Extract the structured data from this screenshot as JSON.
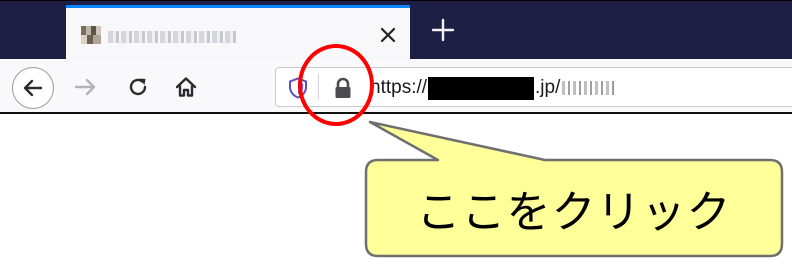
{
  "browser": {
    "tab": {
      "favicon_icon": "site-favicon-pixelated",
      "close_icon": "×"
    },
    "new_tab_icon": "+",
    "toolbar": {
      "back_icon": "arrow-left-icon",
      "forward_icon": "arrow-right-icon",
      "reload_icon": "reload-icon",
      "home_icon": "home-icon"
    },
    "urlbar": {
      "shield_icon": "tracking-protection-shield-icon",
      "lock_icon": "padlock-icon",
      "url_prefix": "https://",
      "url_suffix": ".jp/"
    }
  },
  "annotation": {
    "callout_text": "ここをクリック",
    "highlight_color": "#ff0000",
    "callout_fill": "#ffff99"
  },
  "colors": {
    "titlebar": "#1f1f45",
    "tab_active": "#f8f8fa",
    "toolbar": "#f9f9fb"
  }
}
